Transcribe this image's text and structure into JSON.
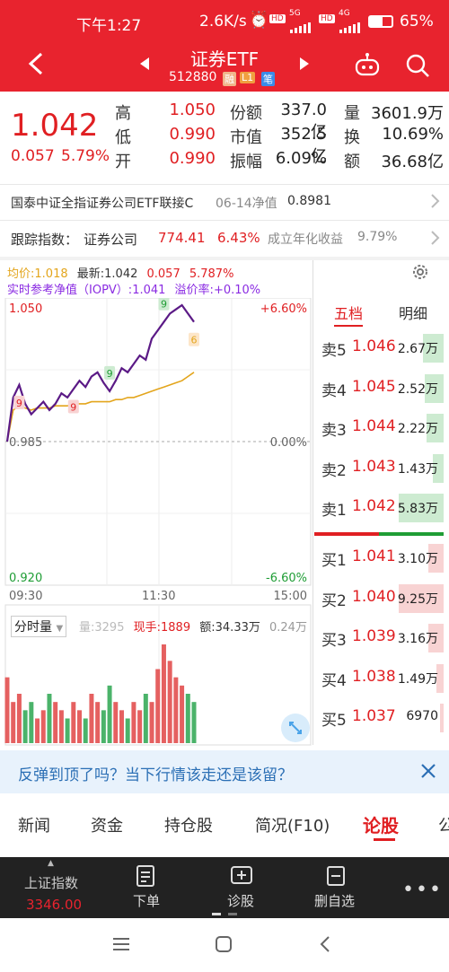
{
  "status": {
    "time": "下午1:27",
    "speed": "2.6K/s",
    "net1": "5G",
    "net2": "4G",
    "battery": "65%"
  },
  "header": {
    "title": "证券ETF",
    "code": "512880",
    "badges": [
      "融",
      "L1",
      "笔"
    ]
  },
  "quote": {
    "price": "1.042",
    "change": "0.057",
    "pct": "5.79%",
    "rows": [
      {
        "l1": "高",
        "v1": "1.050",
        "l2": "份额",
        "v2": "337.0亿",
        "l3": "量",
        "v3": "3601.9万"
      },
      {
        "l1": "低",
        "v1": "0.990",
        "l2": "市值",
        "v2": "352.5亿",
        "l3": "换",
        "v3": "10.69%"
      },
      {
        "l1": "开",
        "v1": "0.990",
        "l2": "振幅",
        "v2": "6.09%",
        "l3": "额",
        "v3": "36.68亿"
      }
    ]
  },
  "linked": {
    "name": "国泰中证全指证券公司ETF联接C",
    "date": "06-14净值",
    "nav": "0.8981"
  },
  "tracking": {
    "label": "跟踪指数：",
    "index": "证券公司",
    "value": "774.41",
    "pct": "6.43%",
    "since_label": "成立年化收益",
    "since_value": "9.79%"
  },
  "chart": {
    "avg_label": "均价:",
    "avg_value": "1.018",
    "last_label": "最新:",
    "last_value": "1.042",
    "last_chg": "0.057",
    "last_pct": "5.787%",
    "iopv_label": "实时参考净值（IOPV）:",
    "iopv_value": "1.041",
    "premium_label": "溢价率:",
    "premium_value": "+0.10%",
    "y_top": "1.050",
    "y_mid": "0.985",
    "y_bot": "0.920",
    "p_top": "+6.60%",
    "p_mid": "0.00%",
    "p_bot": "-6.60%",
    "t_start": "09:30",
    "t_mid": "11:30",
    "t_end": "15:00",
    "vol_label": "分时量",
    "vol_total_label": "量:",
    "vol_total": "3295",
    "hand_label": "现手:",
    "hand": "1889",
    "amt_label": "额:",
    "amt": "34.33万",
    "amt_max": "0.24万",
    "markers": [
      "9",
      "9",
      "9",
      "9",
      "9",
      "6"
    ]
  },
  "chart_data": {
    "type": "line",
    "title": "",
    "ylim": [
      0.92,
      1.05
    ],
    "series": [
      {
        "name": "price",
        "values": [
          0.985,
          1.006,
          1.012,
          1.003,
          0.998,
          1.001,
          1.004,
          1.0,
          1.003,
          1.008,
          1.006,
          1.01,
          1.014,
          1.011,
          1.016,
          1.018,
          1.013,
          1.009,
          1.014,
          1.02,
          1.018,
          1.022,
          1.026,
          1.024,
          1.034,
          1.038,
          1.042,
          1.046,
          1.048,
          1.05,
          1.046,
          1.042
        ]
      },
      {
        "name": "avg",
        "values": [
          0.985,
          1.0,
          1.002,
          1.001,
          1.0,
          1.001,
          1.001,
          1.001,
          1.002,
          1.002,
          1.002,
          1.003,
          1.003,
          1.003,
          1.004,
          1.004,
          1.004,
          1.004,
          1.005,
          1.005,
          1.006,
          1.006,
          1.007,
          1.008,
          1.009,
          1.01,
          1.011,
          1.012,
          1.013,
          1.014,
          1.016,
          1.018
        ]
      }
    ],
    "volume": [
      8,
      5,
      6,
      4,
      5,
      3,
      4,
      6,
      5,
      4,
      3,
      5,
      4,
      3,
      6,
      5,
      4,
      7,
      5,
      4,
      3,
      5,
      4,
      6,
      5,
      9,
      12,
      10,
      8,
      7,
      6,
      5
    ]
  },
  "orderbook": {
    "tab1": "五档",
    "tab2": "明细",
    "asks": [
      {
        "label": "卖5",
        "price": "1.046",
        "vol": "2.67万",
        "ratio": 0.46
      },
      {
        "label": "卖4",
        "price": "1.045",
        "vol": "2.52万",
        "ratio": 0.43
      },
      {
        "label": "卖3",
        "price": "1.044",
        "vol": "2.22万",
        "ratio": 0.38
      },
      {
        "label": "卖2",
        "price": "1.043",
        "vol": "1.43万",
        "ratio": 0.25
      },
      {
        "label": "卖1",
        "price": "1.042",
        "vol": "5.83万",
        "ratio": 1.0
      }
    ],
    "bids": [
      {
        "label": "买1",
        "price": "1.041",
        "vol": "3.10万",
        "ratio": 0.34
      },
      {
        "label": "买2",
        "price": "1.040",
        "vol": "9.25万",
        "ratio": 1.0
      },
      {
        "label": "买3",
        "price": "1.039",
        "vol": "3.16万",
        "ratio": 0.34
      },
      {
        "label": "买4",
        "price": "1.038",
        "vol": "1.49万",
        "ratio": 0.16
      },
      {
        "label": "买5",
        "price": "1.037",
        "vol": "6970",
        "ratio": 0.08
      }
    ]
  },
  "banner": {
    "text": "反弹到顶了吗？当下行情该走还是该留？"
  },
  "tabs": [
    "新闻",
    "资金",
    "持仓股",
    "简况(F10)",
    "论股",
    "公"
  ],
  "bottom": {
    "index_label": "上证指数",
    "index_value": "3346.00",
    "order": "下单",
    "diagnose": "诊股",
    "remove": "删自选"
  },
  "colors": {
    "brand": "#e8232e",
    "up": "#e01f22",
    "down": "#1f9d35",
    "avg_line": "#e3a51c",
    "price_line": "#5b1a86"
  }
}
